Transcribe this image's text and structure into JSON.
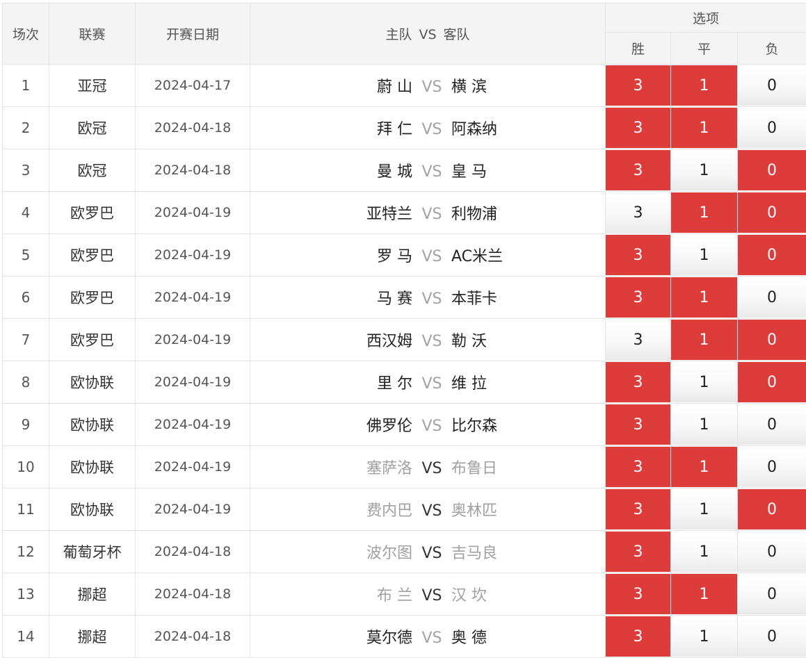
{
  "header": {
    "no": "场次",
    "league": "联赛",
    "date": "开赛日期",
    "home": "主队",
    "vs": "VS",
    "away": "客队",
    "options": "选项",
    "win": "胜",
    "draw": "平",
    "loss": "负"
  },
  "colors": {
    "selected": "#de3b3b",
    "unselected": "#f5f5f5"
  },
  "rows": [
    {
      "no": "1",
      "league": "亚冠",
      "date": "2024-04-17",
      "home": "蔚 山",
      "vs": "VS",
      "away": "横 滨",
      "win": "3",
      "draw": "1",
      "loss": "0",
      "win_selected": true,
      "draw_selected": true,
      "loss_selected": false
    },
    {
      "no": "2",
      "league": "欧冠",
      "date": "2024-04-18",
      "home": "拜 仁",
      "vs": "VS",
      "away": "阿森纳",
      "win": "3",
      "draw": "1",
      "loss": "0",
      "win_selected": true,
      "draw_selected": true,
      "loss_selected": false
    },
    {
      "no": "3",
      "league": "欧冠",
      "date": "2024-04-18",
      "home": "曼 城",
      "vs": "VS",
      "away": "皇 马",
      "win": "3",
      "draw": "1",
      "loss": "0",
      "win_selected": true,
      "draw_selected": false,
      "loss_selected": true
    },
    {
      "no": "4",
      "league": "欧罗巴",
      "date": "2024-04-19",
      "home": "亚特兰",
      "vs": "VS",
      "away": "利物浦",
      "win": "3",
      "draw": "1",
      "loss": "0",
      "win_selected": false,
      "draw_selected": true,
      "loss_selected": true
    },
    {
      "no": "5",
      "league": "欧罗巴",
      "date": "2024-04-19",
      "home": "罗 马",
      "vs": "VS",
      "away": "AC米兰",
      "win": "3",
      "draw": "1",
      "loss": "0",
      "win_selected": true,
      "draw_selected": false,
      "loss_selected": true
    },
    {
      "no": "6",
      "league": "欧罗巴",
      "date": "2024-04-19",
      "home": "马 赛",
      "vs": "VS",
      "away": "本菲卡",
      "win": "3",
      "draw": "1",
      "loss": "0",
      "win_selected": true,
      "draw_selected": true,
      "loss_selected": false
    },
    {
      "no": "7",
      "league": "欧罗巴",
      "date": "2024-04-19",
      "home": "西汉姆",
      "vs": "VS",
      "away": "勒 沃",
      "win": "3",
      "draw": "1",
      "loss": "0",
      "win_selected": false,
      "draw_selected": true,
      "loss_selected": true
    },
    {
      "no": "8",
      "league": "欧协联",
      "date": "2024-04-19",
      "home": "里 尔",
      "vs": "VS",
      "away": "维 拉",
      "win": "3",
      "draw": "1",
      "loss": "0",
      "win_selected": true,
      "draw_selected": false,
      "loss_selected": true
    },
    {
      "no": "9",
      "league": "欧协联",
      "date": "2024-04-19",
      "home": "佛罗伦",
      "vs": "VS",
      "away": "比尔森",
      "win": "3",
      "draw": "1",
      "loss": "0",
      "win_selected": true,
      "draw_selected": false,
      "loss_selected": false
    },
    {
      "no": "10",
      "league": "欧协联",
      "date": "2024-04-19",
      "home": "塞萨洛",
      "vs": "VS",
      "away": "布鲁日",
      "win": "3",
      "draw": "1",
      "loss": "0",
      "win_selected": true,
      "draw_selected": true,
      "loss_selected": false,
      "future": true
    },
    {
      "no": "11",
      "league": "欧协联",
      "date": "2024-04-19",
      "home": "费内巴",
      "vs": "VS",
      "away": "奥林匹",
      "win": "3",
      "draw": "1",
      "loss": "0",
      "win_selected": true,
      "draw_selected": false,
      "loss_selected": true,
      "future": true
    },
    {
      "no": "12",
      "league": "葡萄牙杯",
      "date": "2024-04-18",
      "home": "波尔图",
      "vs": "VS",
      "away": "吉马良",
      "win": "3",
      "draw": "1",
      "loss": "0",
      "win_selected": true,
      "draw_selected": false,
      "loss_selected": false,
      "future": true
    },
    {
      "no": "13",
      "league": "挪超",
      "date": "2024-04-18",
      "home": "布 兰",
      "vs": "VS",
      "away": "汉 坎",
      "win": "3",
      "draw": "1",
      "loss": "0",
      "win_selected": true,
      "draw_selected": true,
      "loss_selected": false,
      "future": true
    },
    {
      "no": "14",
      "league": "挪超",
      "date": "2024-04-18",
      "home": "莫尔德",
      "vs": "VS",
      "away": "奥 德",
      "win": "3",
      "draw": "1",
      "loss": "0",
      "win_selected": true,
      "draw_selected": false,
      "loss_selected": false
    }
  ]
}
